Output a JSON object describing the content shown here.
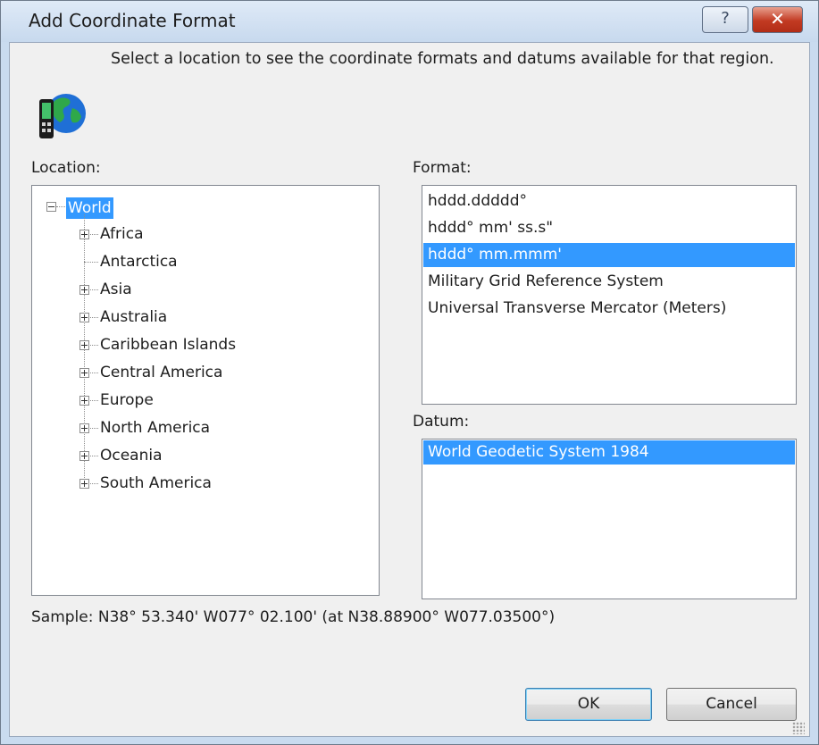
{
  "window": {
    "title": "Add Coordinate Format"
  },
  "titlebar": {
    "help_label": "?",
    "close_label": "✕"
  },
  "description": "Select a location to see the coordinate formats and datums available for that region.",
  "location": {
    "label": "Location:",
    "root": "World",
    "children": [
      {
        "label": "Africa",
        "expandable": true
      },
      {
        "label": "Antarctica",
        "expandable": false
      },
      {
        "label": "Asia",
        "expandable": true
      },
      {
        "label": "Australia",
        "expandable": true
      },
      {
        "label": "Caribbean Islands",
        "expandable": true
      },
      {
        "label": "Central America",
        "expandable": true
      },
      {
        "label": "Europe",
        "expandable": true
      },
      {
        "label": "North America",
        "expandable": true
      },
      {
        "label": "Oceania",
        "expandable": true
      },
      {
        "label": "South America",
        "expandable": true
      }
    ]
  },
  "format": {
    "label": "Format:",
    "items": [
      "hddd.ddddd°",
      "hddd° mm' ss.s\"",
      "hddd° mm.mmm'",
      "Military Grid Reference System",
      "Universal Transverse Mercator (Meters)"
    ],
    "selected_index": 2
  },
  "datum": {
    "label": "Datum:",
    "items": [
      "World Geodetic System 1984"
    ],
    "selected_index": 0
  },
  "sample": "Sample: N38° 53.340'  W077° 02.100' (at N38.88900°  W077.03500°)",
  "buttons": {
    "ok": "OK",
    "cancel": "Cancel"
  },
  "colors": {
    "selection": "#3399ff",
    "dialog_bg": "#f0f0f0",
    "frame": "#c9dbef",
    "close_button": "#c23a22"
  }
}
